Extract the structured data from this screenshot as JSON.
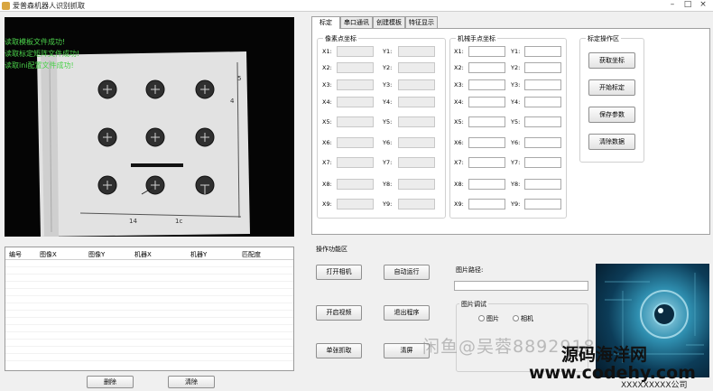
{
  "window": {
    "title": "爱普森机器人识别抓取",
    "controls": [
      "–",
      "□",
      "×"
    ]
  },
  "camera": {
    "log_lines": [
      "读取模板文件成功!",
      "读取标定矩阵文件成功!",
      "读取ini配置文件成功!"
    ],
    "board_marks": [
      "14",
      "1c",
      "4",
      "5"
    ]
  },
  "results_table": {
    "headers": [
      "编号",
      "图像X",
      "图像Y",
      "机器X",
      "机器Y",
      "匹配度"
    ],
    "rows": []
  },
  "table_buttons": {
    "delete": "删除",
    "clear": "清除"
  },
  "tabs": [
    "标定",
    "串口通讯",
    "创建模板",
    "特征显示"
  ],
  "calibration": {
    "pixel_group_title": "像素点坐标",
    "robot_group_title": "机械手点坐标",
    "op_group_title": "标定操作区",
    "x_labels": [
      "X1:",
      "X2:",
      "X3:",
      "X4:",
      "X5:",
      "X6:",
      "X7:",
      "X8:",
      "X9:"
    ],
    "y_labels": [
      "Y1:",
      "Y2:",
      "Y3:",
      "Y4:",
      "Y5:",
      "Y6:",
      "Y7:",
      "Y8:",
      "Y9:"
    ],
    "buttons": [
      "获取坐标",
      "开始标定",
      "保存参数",
      "清除数据"
    ]
  },
  "operations": {
    "title": "操作功能区",
    "buttons": [
      "打开相机",
      "自动运行",
      "开启视频",
      "退出程序",
      "单张抓取",
      "清屏"
    ],
    "path_label": "图片路径:",
    "path_value": "",
    "debug_title": "图片调试",
    "radio_options": [
      "图片",
      "相机"
    ]
  },
  "watermark": {
    "line1": "闲鱼@吴蓉8892918",
    "line2": "源码海洋网",
    "line3": "www.codehy.com",
    "small": "XXXXXXXXX公司"
  }
}
